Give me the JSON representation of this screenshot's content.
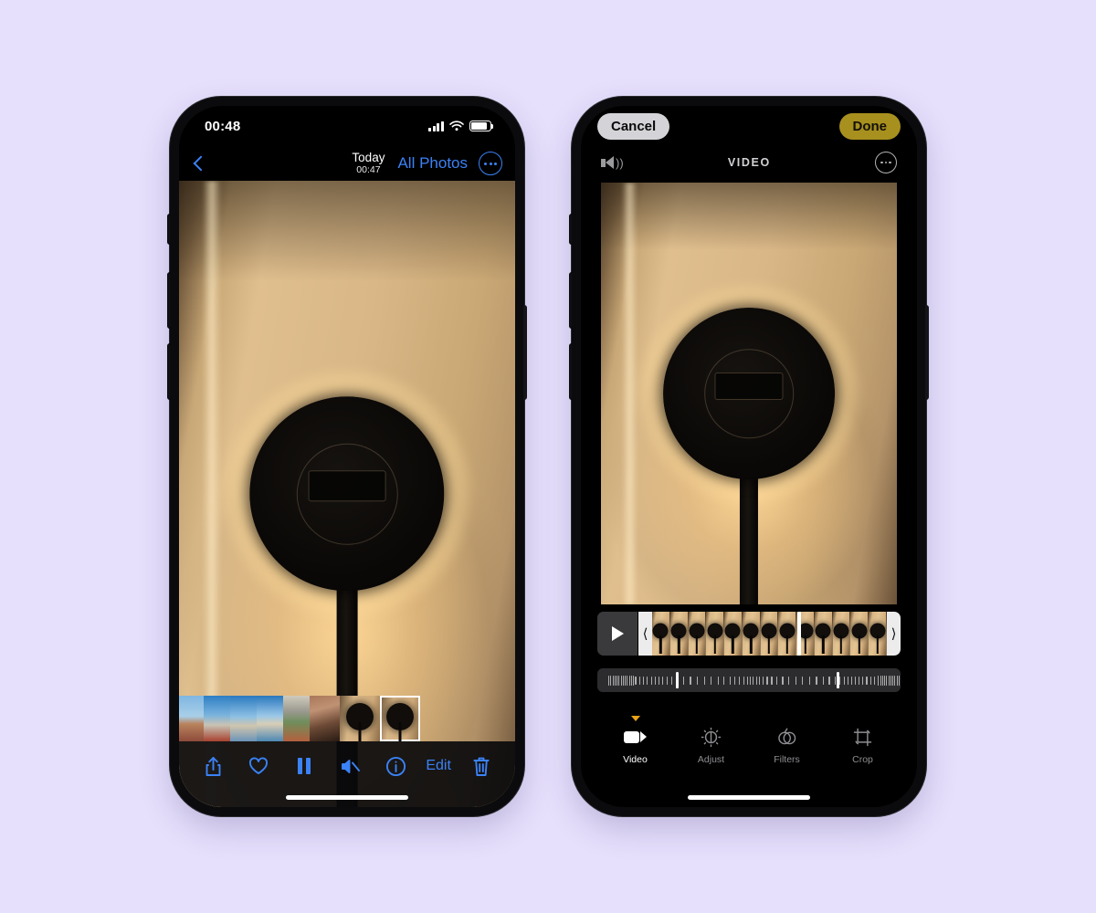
{
  "page": {
    "background_color": "#e6e0fc"
  },
  "left_phone": {
    "status_bar": {
      "time": "00:48",
      "signal_icon": "cellular-bars-icon",
      "wifi_icon": "wifi-icon",
      "battery_icon": "battery-icon"
    },
    "nav_bar": {
      "back_icon": "chevron-left-icon",
      "title": "Today",
      "subtitle": "00:47",
      "all_photos_label": "All Photos",
      "more_icon": "more-circle-icon"
    },
    "toolbar": {
      "share_icon": "share-icon",
      "favorite_icon": "heart-icon",
      "pause_icon": "pause-icon",
      "mute_icon": "speaker-mute-icon",
      "info_icon": "info-icon",
      "edit_label": "Edit",
      "delete_icon": "trash-icon"
    },
    "thumbnails": [
      {
        "name": "thumb-sky",
        "selected": false
      },
      {
        "name": "thumb-city-1",
        "selected": false
      },
      {
        "name": "thumb-city-2",
        "selected": false
      },
      {
        "name": "thumb-city-3",
        "selected": false
      },
      {
        "name": "thumb-stadium",
        "selected": false
      },
      {
        "name": "thumb-arm",
        "selected": false
      },
      {
        "name": "thumb-lamp-1",
        "selected": false
      },
      {
        "name": "thumb-lamp-2",
        "selected": true
      }
    ]
  },
  "right_phone": {
    "header": {
      "cancel_label": "Cancel",
      "done_label": "Done",
      "cancel_color": "#d4d4d8",
      "done_color": "#a8901e"
    },
    "sub_header": {
      "speaker_icon": "speaker-on-icon",
      "media_type_label": "VIDEO",
      "more_icon": "more-circle-icon"
    },
    "timeline": {
      "play_icon": "play-icon",
      "trim_start_icon": "trim-handle-left-icon",
      "trim_end_icon": "trim-handle-right-icon",
      "frame_count": 13,
      "playhead_position_percent": 62
    },
    "scrubber": {
      "handle_left_percent": 26,
      "handle_right_percent": 79,
      "tick_count": 74
    },
    "tabs": [
      {
        "label": "Video",
        "icon": "video-camera-icon",
        "active": true
      },
      {
        "label": "Adjust",
        "icon": "adjust-dial-icon",
        "active": false
      },
      {
        "label": "Filters",
        "icon": "filters-circles-icon",
        "active": false
      },
      {
        "label": "Crop",
        "icon": "crop-rotate-icon",
        "active": false
      }
    ],
    "active_indicator_color": "#e8a317"
  }
}
